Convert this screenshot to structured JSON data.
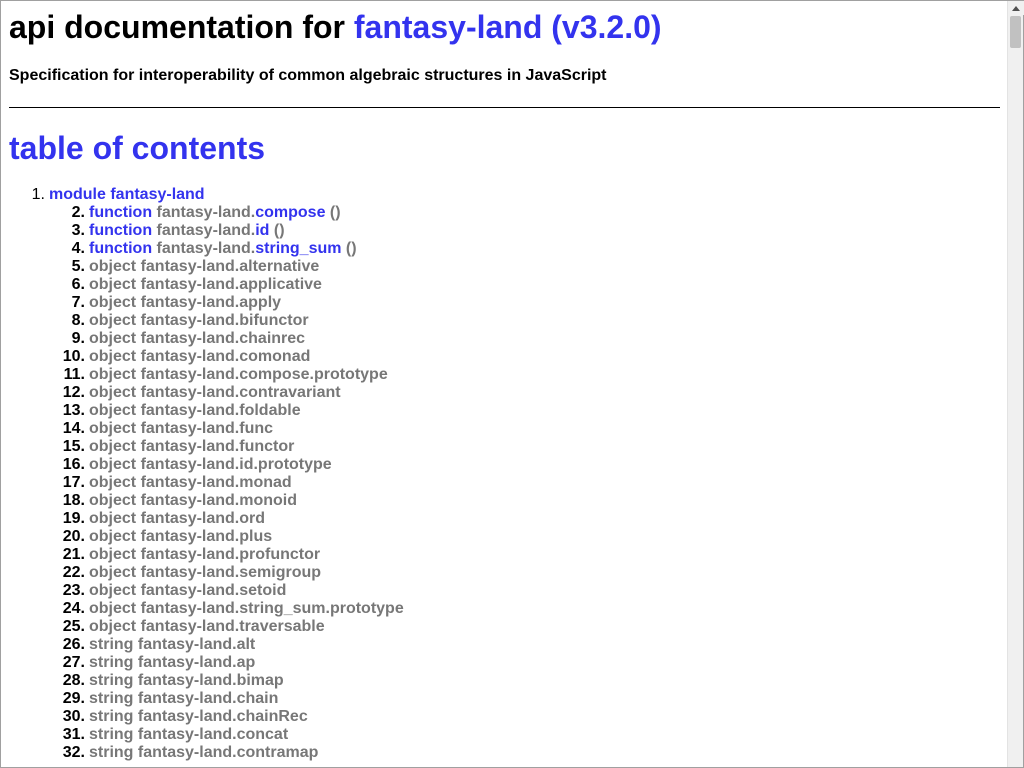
{
  "header": {
    "title_prefix": "api documentation for",
    "title_link": "fantasy-land (v3.2.0)",
    "subtitle": "Specification for interoperability of common algebraic structures in JavaScript"
  },
  "toc": {
    "title": "table of contents",
    "module": {
      "number": "1.",
      "label": "module fantasy-land"
    },
    "items": [
      {
        "n": "2",
        "kw": "function",
        "prefix": "fantasy-land.",
        "name": "compose",
        "suffix": " ()"
      },
      {
        "n": "3",
        "kw": "function",
        "prefix": "fantasy-land.",
        "name": "id",
        "suffix": " ()"
      },
      {
        "n": "4",
        "kw": "function",
        "prefix": "fantasy-land.",
        "name": "string_sum",
        "suffix": " ()"
      },
      {
        "n": "5",
        "text": "object fantasy-land.alternative"
      },
      {
        "n": "6",
        "text": "object fantasy-land.applicative"
      },
      {
        "n": "7",
        "text": "object fantasy-land.apply"
      },
      {
        "n": "8",
        "text": "object fantasy-land.bifunctor"
      },
      {
        "n": "9",
        "text": "object fantasy-land.chainrec"
      },
      {
        "n": "10",
        "text": "object fantasy-land.comonad"
      },
      {
        "n": "11",
        "text": "object fantasy-land.compose.prototype"
      },
      {
        "n": "12",
        "text": "object fantasy-land.contravariant"
      },
      {
        "n": "13",
        "text": "object fantasy-land.foldable"
      },
      {
        "n": "14",
        "text": "object fantasy-land.func"
      },
      {
        "n": "15",
        "text": "object fantasy-land.functor"
      },
      {
        "n": "16",
        "text": "object fantasy-land.id.prototype"
      },
      {
        "n": "17",
        "text": "object fantasy-land.monad"
      },
      {
        "n": "18",
        "text": "object fantasy-land.monoid"
      },
      {
        "n": "19",
        "text": "object fantasy-land.ord"
      },
      {
        "n": "20",
        "text": "object fantasy-land.plus"
      },
      {
        "n": "21",
        "text": "object fantasy-land.profunctor"
      },
      {
        "n": "22",
        "text": "object fantasy-land.semigroup"
      },
      {
        "n": "23",
        "text": "object fantasy-land.setoid"
      },
      {
        "n": "24",
        "text": "object fantasy-land.string_sum.prototype"
      },
      {
        "n": "25",
        "text": "object fantasy-land.traversable"
      },
      {
        "n": "26",
        "text": "string fantasy-land.alt"
      },
      {
        "n": "27",
        "text": "string fantasy-land.ap"
      },
      {
        "n": "28",
        "text": "string fantasy-land.bimap"
      },
      {
        "n": "29",
        "text": "string fantasy-land.chain"
      },
      {
        "n": "30",
        "text": "string fantasy-land.chainRec"
      },
      {
        "n": "31",
        "text": "string fantasy-land.concat"
      },
      {
        "n": "32",
        "text": "string fantasy-land.contramap"
      }
    ]
  },
  "colors": {
    "link": "#3333ee",
    "muted": "#777777",
    "text": "#000000"
  }
}
